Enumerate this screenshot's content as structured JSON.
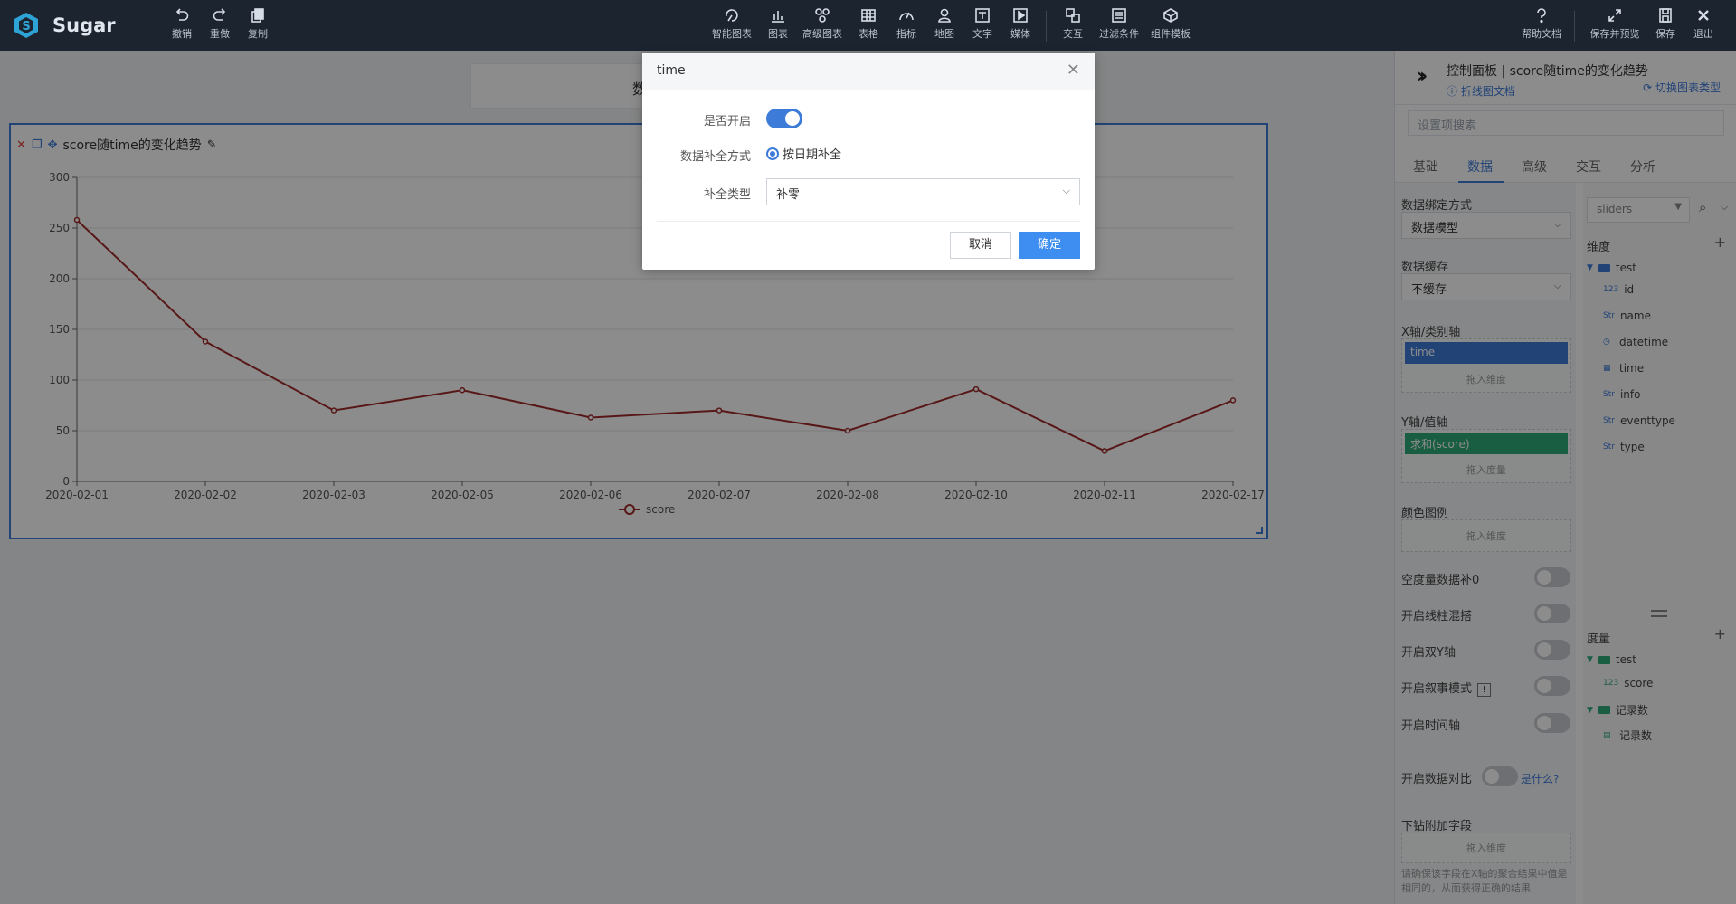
{
  "app": {
    "name": "Sugar"
  },
  "toolbar": {
    "left": [
      {
        "icon": "undo-icon",
        "label": "撤销"
      },
      {
        "icon": "redo-icon",
        "label": "重做"
      },
      {
        "icon": "copy-icon",
        "label": "复制"
      }
    ],
    "center": [
      {
        "icon": "smart-chart-icon",
        "label": "智能图表"
      },
      {
        "icon": "bar-chart-icon",
        "label": "图表"
      },
      {
        "icon": "advanced-chart-icon",
        "label": "高级图表"
      },
      {
        "icon": "table-icon",
        "label": "表格"
      },
      {
        "icon": "gauge-icon",
        "label": "指标"
      },
      {
        "icon": "map-pin-icon",
        "label": "地图"
      },
      {
        "icon": "text-icon",
        "label": "文字"
      },
      {
        "icon": "media-icon",
        "label": "媒体"
      },
      {
        "icon": "interaction-icon",
        "label": "交互"
      },
      {
        "icon": "filter-icon",
        "label": "过滤条件"
      },
      {
        "icon": "component-template-icon",
        "label": "组件模板"
      }
    ],
    "right": [
      {
        "icon": "help-icon",
        "label": "帮助文档"
      },
      {
        "icon": "expand-icon",
        "label": "保存并预览"
      },
      {
        "icon": "save-icon",
        "label": "保存"
      },
      {
        "icon": "exit-icon",
        "label": "退出"
      }
    ]
  },
  "canvas": {
    "header_ghost_text": "数",
    "widget_title": "score随time的变化趋势"
  },
  "chart_data": {
    "type": "line",
    "categories": [
      "2020-02-01",
      "2020-02-02",
      "2020-02-03",
      "2020-02-05",
      "2020-02-06",
      "2020-02-07",
      "2020-02-08",
      "2020-02-10",
      "2020-02-11",
      "2020-02-17"
    ],
    "series": [
      {
        "name": "score",
        "values": [
          258,
          138,
          70,
          90,
          63,
          70,
          50,
          91,
          30,
          80
        ],
        "color": "#a12a2a"
      }
    ],
    "ylim": [
      0,
      300
    ],
    "yticks": [
      0,
      50,
      100,
      150,
      200,
      250,
      300
    ],
    "grid": true,
    "legend": "bottom-center"
  },
  "panel": {
    "title": "控制面板 | score随time的变化趋势",
    "doc_link": "折线图文档",
    "switch_link": "切换图表类型",
    "search_placeholder": "设置项搜索",
    "tabs": [
      "基础",
      "数据",
      "高级",
      "交互",
      "分析"
    ],
    "active_tab": "数据",
    "binding_label": "数据绑定方式",
    "binding_value": "数据模型",
    "cache_label": "数据缓存",
    "cache_value": "不缓存",
    "xaxis_label": "X轴/类别轴",
    "xaxis_pill": "time",
    "drop_dimension": "拖入维度",
    "yaxis_label": "Y轴/值轴",
    "yaxis_pill": "求和(score)",
    "drop_measure": "拖入度量",
    "color_label": "颜色图例",
    "toggles": [
      {
        "label": "空度量数据补0",
        "on": false
      },
      {
        "label": "开启线柱混搭",
        "on": false
      },
      {
        "label": "开启双Y轴",
        "on": false
      },
      {
        "label": "开启叙事模式",
        "on": false
      },
      {
        "label": "开启时间轴",
        "on": false
      }
    ],
    "compare_label": "开启数据对比",
    "what_link": "是什么?",
    "drill_label": "下钻附加字段",
    "foot_note": "请确保该字段在X轴的聚合结果中值是相同的，从而获得正确的结果"
  },
  "fields": {
    "model_select": "sliders",
    "dimensions_title": "维度",
    "dimension_folder": "test",
    "dimension_items": [
      {
        "type": "123",
        "name": "id"
      },
      {
        "type": "Str",
        "name": "name"
      },
      {
        "type": "datetime",
        "name": "datetime"
      },
      {
        "type": "date",
        "name": "time"
      },
      {
        "type": "Str",
        "name": "info"
      },
      {
        "type": "Str",
        "name": "eventtype"
      },
      {
        "type": "Str",
        "name": "type"
      }
    ],
    "measures_title": "度量",
    "measure_folder": "test",
    "measure_items": [
      {
        "type": "123",
        "name": "score"
      }
    ],
    "count_folder": "记录数",
    "count_item": "记录数"
  },
  "modal": {
    "title": "time",
    "enable_label": "是否开启",
    "enable_on": true,
    "fill_method_label": "数据补全方式",
    "fill_method_value": "按日期补全",
    "fill_type_label": "补全类型",
    "fill_type_value": "补零",
    "cancel": "取消",
    "ok": "确定"
  },
  "colors": {
    "accent": "#3d7bd8",
    "topbar": "#1c2430",
    "line": "#a12a2a",
    "measure": "#2eaa7a"
  }
}
